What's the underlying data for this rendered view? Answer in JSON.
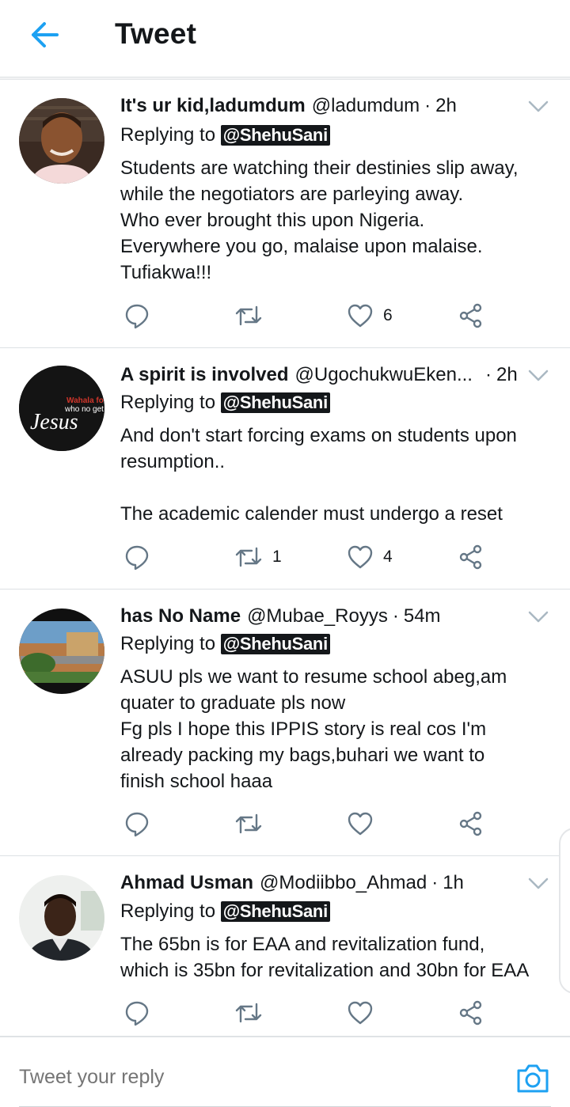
{
  "header": {
    "title": "Tweet"
  },
  "tweets": [
    {
      "name": "It's ur kid,ladumdum",
      "handle": "@ladumdum",
      "dot": "·",
      "time": "2h",
      "replying_prefix": "Replying to",
      "replying_to": "@ShehuSani",
      "lines": [
        "Students are watching their destinies slip away,",
        "while the negotiators are parleying away.",
        "Who ever brought this upon Nigeria.",
        "Everywhere you go, malaise upon malaise.",
        "Tufiakwa!!!"
      ],
      "retweets": "",
      "likes": "6"
    },
    {
      "name": "A spirit is involved",
      "handle": "@UgochukwuEken...",
      "dot": "·",
      "time": "2h",
      "replying_prefix": "Replying to",
      "replying_to": "@ShehuSani",
      "lines": [
        "And don't start forcing exams on students upon",
        "resumption..",
        "",
        "The academic calender must undergo a reset"
      ],
      "retweets": "1",
      "likes": "4",
      "avatar_text": {
        "line1": "Wahala for",
        "line2": "who no get",
        "line3": "Jesus"
      }
    },
    {
      "name": "has No Name",
      "handle": "@Mubae_Royys",
      "dot": "·",
      "time": "54m",
      "replying_prefix": "Replying to",
      "replying_to": "@ShehuSani",
      "lines": [
        "ASUU pls we want to resume school abeg,am",
        "quater to graduate pls now",
        "Fg pls I hope this IPPIS story is real cos I'm",
        "already packing my bags,buhari we want to",
        "finish school haaa"
      ],
      "retweets": "",
      "likes": ""
    },
    {
      "name": "Ahmad Usman",
      "handle": "@Modiibbo_Ahmad",
      "dot": "·",
      "time": "1h",
      "replying_prefix": "Replying to",
      "replying_to": "@ShehuSani",
      "lines": [
        "The 65bn is for EAA and revitalization fund,",
        "which is 35bn for revitalization and 30bn for EAA"
      ],
      "retweets": "",
      "likes": ""
    }
  ],
  "reply_bar": {
    "placeholder": "Tweet your reply"
  },
  "colors": {
    "accent": "#1da1f2",
    "icon_gray": "#657786",
    "text": "#14171a",
    "divider": "#e1e4e7"
  }
}
